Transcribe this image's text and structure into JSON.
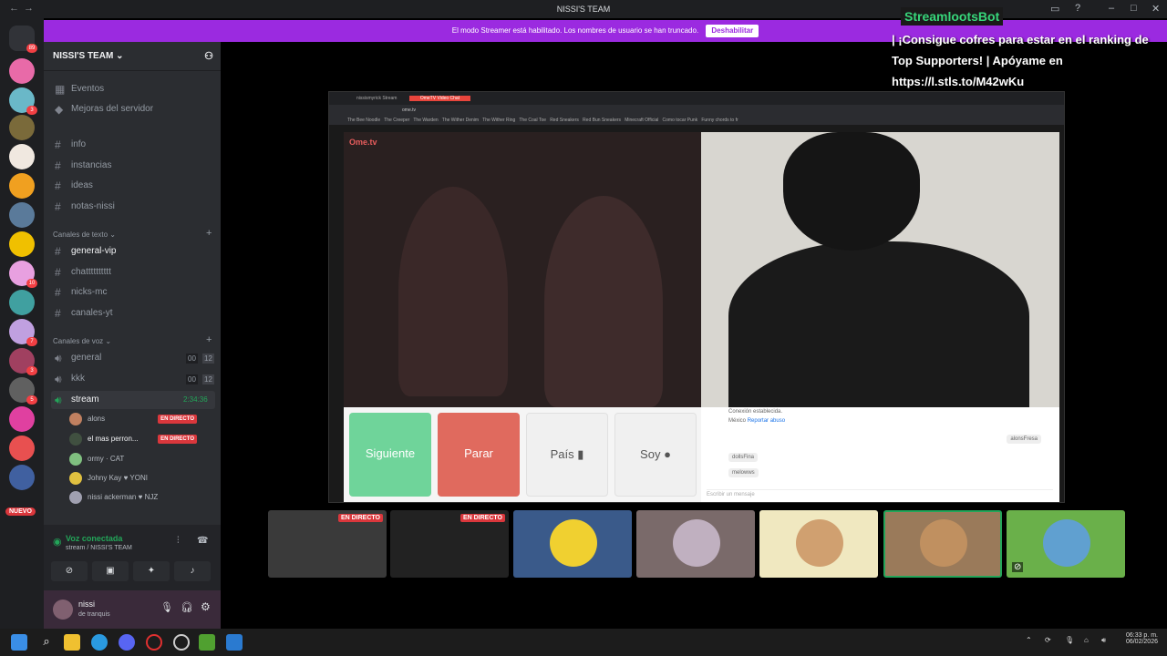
{
  "window": {
    "title": "NISSI'S TEAM"
  },
  "streamer_banner": {
    "text": "El modo Streamer está habilitado. Los nombres de usuario se han truncado.",
    "button": "Deshabilitar"
  },
  "server": {
    "name": "NISSI'S TEAM"
  },
  "sidebar_top": [
    {
      "label": "Eventos"
    },
    {
      "label": "Mejoras del servidor"
    }
  ],
  "channels_top": [
    "info",
    "instancias",
    "ideas",
    "notas-nissi"
  ],
  "text_category": "Canales de texto",
  "text_channels": [
    "general-vip",
    "chatttttttttt",
    "nicks-mc",
    "canales-yt"
  ],
  "voice_category": "Canales de voz",
  "voice_channels": [
    {
      "name": "general",
      "a": "00",
      "b": "12"
    },
    {
      "name": "kkk",
      "a": "00",
      "b": "12"
    },
    {
      "name": "stream",
      "time": "2:34:36"
    }
  ],
  "voice_users": [
    {
      "name": "alons",
      "live": "EN DIRECTO"
    },
    {
      "name": "el mas perron...",
      "live": "EN DIRECTO"
    },
    {
      "name": "ormy",
      "tag": "CAT"
    },
    {
      "name": "Johny Kay",
      "tag": "YONI"
    },
    {
      "name": "nissi ackerman",
      "tag": "NJZ"
    }
  ],
  "voice_panel": {
    "status": "Voz conectada",
    "sub": "stream / NISSI'S TEAM"
  },
  "user_panel": {
    "name": "nissi",
    "status": "de tranquis"
  },
  "server_badges": [
    "89",
    "3",
    "10",
    "7",
    "3",
    "5",
    "NUEVO"
  ],
  "overlay": {
    "bot": "StreamlootsBot",
    "message": "| ¡Consigue cofres para estar en el ranking de Top Supporters! | Apóyame en https://l.stls.to/M42wKu"
  },
  "browser": {
    "tabs": [
      "nissismyrick Stream",
      "OmeTV Video Chat"
    ],
    "url": "ome.tv",
    "bookmarks": [
      "The Bee Noodle",
      "The Creeper",
      "The Warden",
      "The Wither Denim",
      "The Wither Ring",
      "The Coal Toe",
      "Red Sneakers",
      "Red Bun Sneakers",
      "Minecraft Official",
      "Como tocar Punk",
      "Funny chords to fr"
    ]
  },
  "ometv": {
    "logo": "Ome.tv",
    "buttons": {
      "next": "Siguiente",
      "stop": "Parar",
      "country": "País",
      "me": "Soy"
    },
    "chat": {
      "l1": "Conexión establecida.",
      "l2": "México",
      "l3": "Reportar abuso",
      "m1": "alonsFresa",
      "m2": "dollsFina",
      "m3": "melowws",
      "placeholder": "Escribir un mensaje"
    }
  },
  "strip": {
    "live1": "EN DIRECTO",
    "live2": "EN DIRECTO"
  },
  "taskbar": {
    "time": "06:33 p. m.",
    "date": "06/02/2026"
  }
}
